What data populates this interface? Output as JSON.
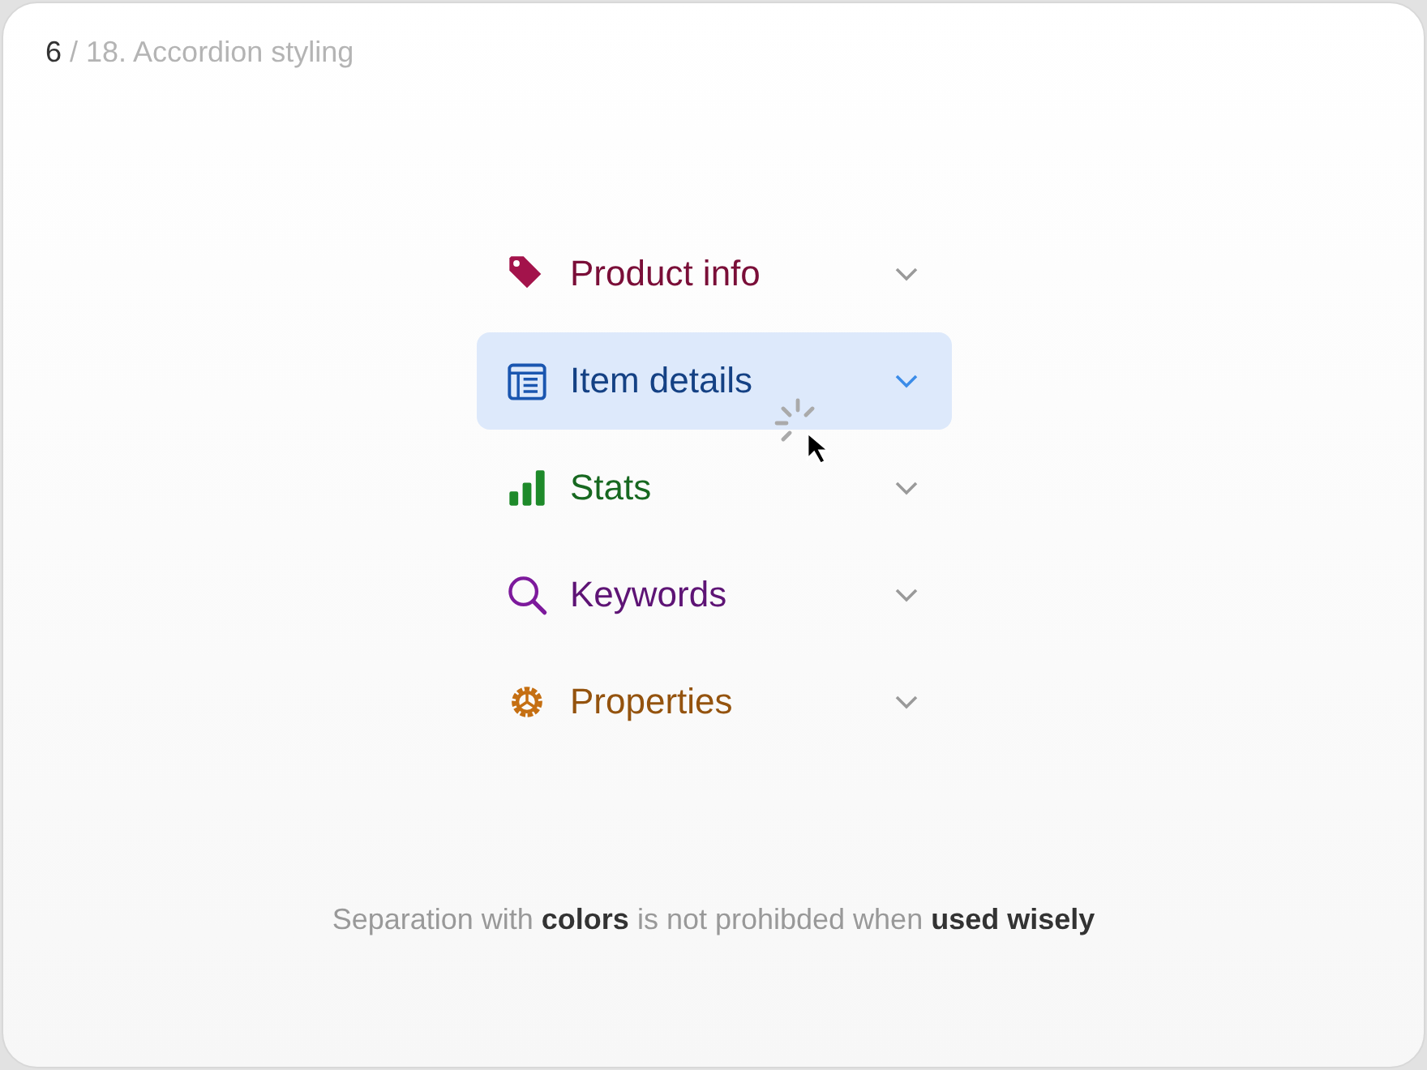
{
  "header": {
    "current": "6",
    "rest": " / 18. Accordion styling"
  },
  "accordion": [
    {
      "label": "Product info",
      "kind": "tag",
      "color": "#a3134b",
      "selected": false
    },
    {
      "label": "Item details",
      "kind": "list",
      "color": "#1a56b0",
      "selected": true
    },
    {
      "label": "Stats",
      "kind": "bars",
      "color": "#1e8a2a",
      "selected": false
    },
    {
      "label": "Keywords",
      "kind": "search",
      "color": "#7d1a9c",
      "selected": false
    },
    {
      "label": "Properties",
      "kind": "gear",
      "color": "#c56f12",
      "selected": false
    }
  ],
  "caption": "Separation with **colors** is not prohibded when **used wisely**"
}
